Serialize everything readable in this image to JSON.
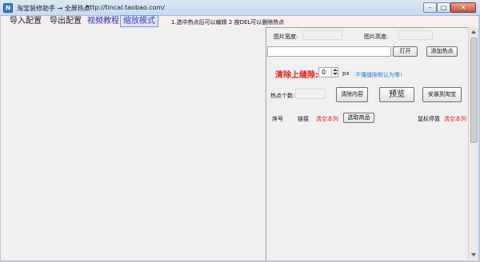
{
  "window": {
    "icon_letter": "N",
    "title": "淘宝装修助手 → 全屏热点",
    "url": "http://tincal.taobao.com/",
    "min_glyph": "–",
    "max_glyph": "□",
    "close_glyph": "✕"
  },
  "menu": {
    "import_label": "导入配置",
    "export_label": "导出配置",
    "video_label": "视频教程",
    "zoom_label": "缩放模式",
    "hint": "1.选中热点后可以编辑 2 按DEL可以删除热点"
  },
  "panel": {
    "image_width_label": "图片宽度:",
    "image_height_label": "图片高度:",
    "open_button": "打开",
    "add_hotspot_button": "添加热点",
    "clear_gap_label": "清除上缝隙:",
    "gap_value": "0",
    "gap_unit": "px",
    "gap_hint": "不懂缝隙默认为零!",
    "hotspot_count_label": "热点个数:",
    "clear_content_button": "清除内容",
    "preview_button": "预览",
    "install_button": "安装到淘宝",
    "col_index": "序号",
    "col_link": "链接",
    "clear_column_1": "清空本列",
    "select_product_button": "选取商品",
    "col_hover": "鼠标停靠",
    "clear_column_2": "清空本列"
  },
  "colors": {
    "accent_red": "#e0261c",
    "hint_blue": "#2f7ad6",
    "menu_blue": "#1d2f9e"
  }
}
